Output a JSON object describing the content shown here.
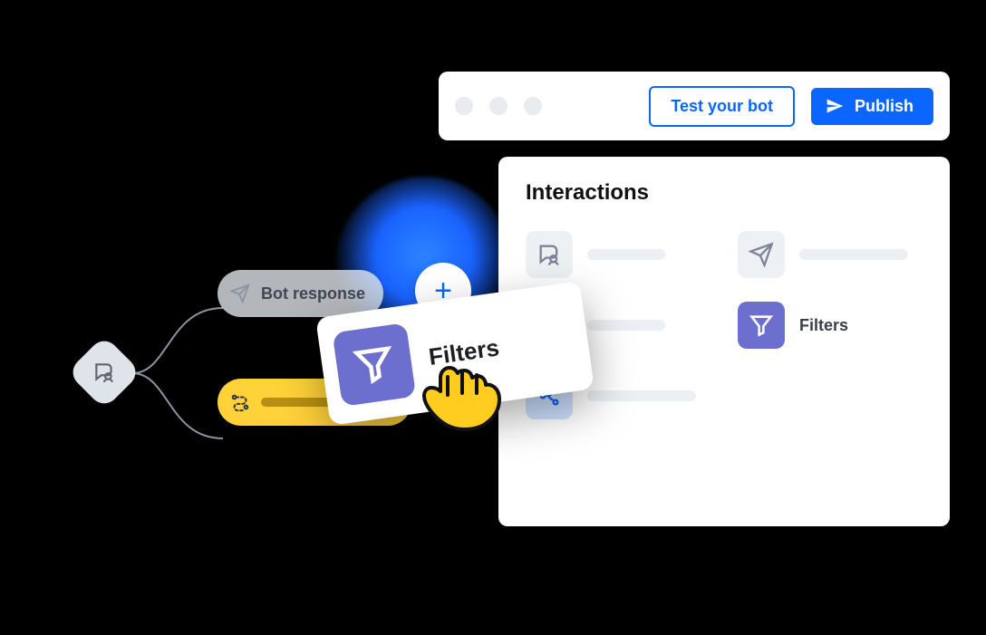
{
  "toolbar": {
    "test_label": "Test your bot",
    "publish_label": "Publish"
  },
  "panel": {
    "title": "Interactions",
    "items": [
      {
        "icon": "chat",
        "variant": "gray",
        "label": null
      },
      {
        "icon": "send",
        "variant": "gray",
        "label": null
      },
      {
        "icon": "tag",
        "variant": "dark",
        "label": null
      },
      {
        "icon": "funnel",
        "variant": "purple",
        "label": "Filters"
      },
      {
        "icon": "branch",
        "variant": "blue",
        "label": null
      }
    ]
  },
  "flow": {
    "bot_response_label": "Bot response"
  },
  "drag_card": {
    "label": "Filters"
  }
}
